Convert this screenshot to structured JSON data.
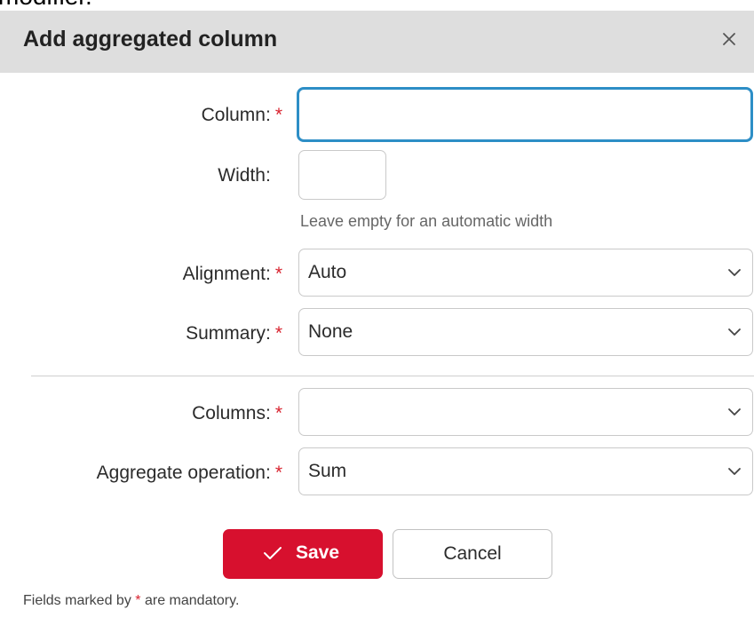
{
  "background_text": "modifier.",
  "dialog": {
    "title": "Add aggregated column",
    "close_label": "×"
  },
  "form": {
    "required_mark": "*",
    "column": {
      "label": "Column:",
      "value": "",
      "required": true
    },
    "width": {
      "label": "Width:",
      "value": "",
      "hint": "Leave empty for an automatic width"
    },
    "alignment": {
      "label": "Alignment:",
      "selected": "Auto",
      "required": true
    },
    "summary": {
      "label": "Summary:",
      "selected": "None",
      "required": true
    },
    "columns": {
      "label": "Columns:",
      "selected": "",
      "required": true
    },
    "aggregate_operation": {
      "label": "Aggregate operation:",
      "selected": "Sum",
      "required": true
    }
  },
  "buttons": {
    "save_label": "Save",
    "cancel_label": "Cancel"
  },
  "footer": {
    "prefix": "Fields marked by",
    "mark": "*",
    "suffix": "are mandatory."
  },
  "icons": {
    "close": "close-icon",
    "chevron": "chevron-down-icon",
    "check": "check-icon"
  },
  "colors": {
    "header_bg": "#dedede",
    "accent_red": "#d7102e",
    "required_red": "#d8232f",
    "focus_blue": "#2d8ec6"
  }
}
